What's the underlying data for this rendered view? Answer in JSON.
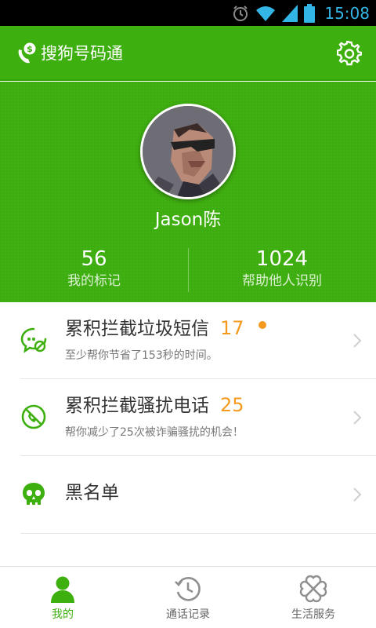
{
  "status_bar": {
    "time": "15:08",
    "icons": [
      "alarm-icon",
      "wifi-icon",
      "signal-icon",
      "battery-icon"
    ],
    "color": "#33b5e5"
  },
  "app_bar": {
    "title": "搜狗号码通",
    "logo_icon": "phone-dollar-icon",
    "settings_icon": "gear-icon",
    "color": "#3daf0e"
  },
  "profile": {
    "avatar_icon": "avatar-portrait",
    "username": "Jason陈",
    "stats": [
      {
        "value": "56",
        "label": "我的标记"
      },
      {
        "value": "1024",
        "label": "帮助他人识别"
      }
    ]
  },
  "list": {
    "items": [
      {
        "icon": "sms-block-icon",
        "title": "累积拦截垃圾短信",
        "count": "17",
        "has_dot": true,
        "subtitle": "至少帮你节省了153秒的时间。"
      },
      {
        "icon": "call-block-icon",
        "title": "累积拦截骚扰电话",
        "count": "25",
        "has_dot": false,
        "subtitle": "帮你减少了25次被诈骗骚扰的机会！"
      },
      {
        "icon": "skull-icon",
        "title": "黑名单",
        "count": "",
        "has_dot": false,
        "subtitle": ""
      }
    ],
    "accent_color": "#f49a1f",
    "chevron_icon": "chevron-right-icon"
  },
  "bottom_nav": {
    "items": [
      {
        "icon": "person-icon",
        "label": "我的",
        "active": true
      },
      {
        "icon": "clock-history-icon",
        "label": "通话记录",
        "active": false
      },
      {
        "icon": "clover-icon",
        "label": "生活服务",
        "active": false
      }
    ],
    "active_color": "#3daf0e"
  }
}
